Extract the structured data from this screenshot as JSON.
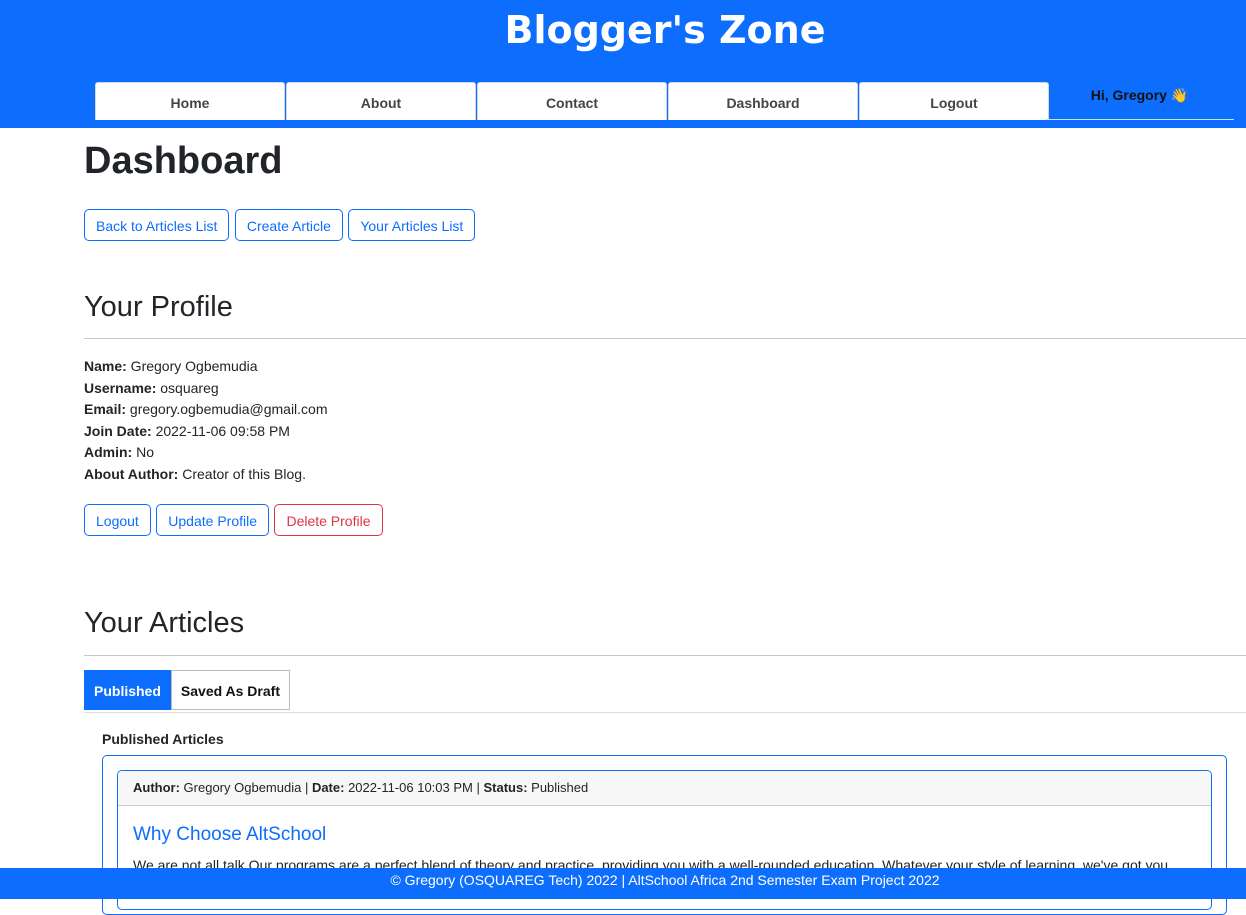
{
  "site": {
    "title": "Blogger's Zone"
  },
  "nav": {
    "items": [
      "Home",
      "About",
      "Contact",
      "Dashboard",
      "Logout"
    ],
    "greeting": "Hi, Gregory 👋"
  },
  "page": {
    "title": "Dashboard"
  },
  "top_buttons": [
    "Back to Articles List",
    "Create Article",
    "Your Articles List"
  ],
  "profile": {
    "section_title": "Your Profile",
    "fields": [
      {
        "label": "Name:",
        "value": " Gregory Ogbemudia"
      },
      {
        "label": "Username:",
        "value": " osquareg"
      },
      {
        "label": "Email:",
        "value": " gregory.ogbemudia@gmail.com"
      },
      {
        "label": "Join Date:",
        "value": " 2022-11-06 09:58 PM"
      },
      {
        "label": "Admin:",
        "value": " No"
      },
      {
        "label": "About Author:",
        "value": " Creator of this Blog."
      }
    ],
    "buttons": {
      "logout": "Logout",
      "update": "Update Profile",
      "delete": "Delete Profile"
    }
  },
  "articles": {
    "section_title": "Your Articles",
    "tabs": [
      "Published",
      "Saved As Draft"
    ],
    "active_tab": "Published",
    "list_title": "Published Articles",
    "items": [
      {
        "author_label": "Author:",
        "author": " Gregory Ogbemudia | ",
        "date_label": "Date:",
        "date": " 2022-11-06 10:03 PM | ",
        "status_label": "Status:",
        "status": " Published",
        "title": "Why Choose AltSchool",
        "excerpt": "We are not all talk Our programs are a perfect blend of theory and practice, providing you with a well-rounded education. Whatever your style of learning, we've got you"
      }
    ]
  },
  "footer": {
    "text": "© Gregory (OSQUAREG Tech) 2022 | AltSchool Africa 2nd Semester Exam Project 2022"
  },
  "colors": {
    "primary": "#0d6efd",
    "danger": "#dc3545"
  }
}
